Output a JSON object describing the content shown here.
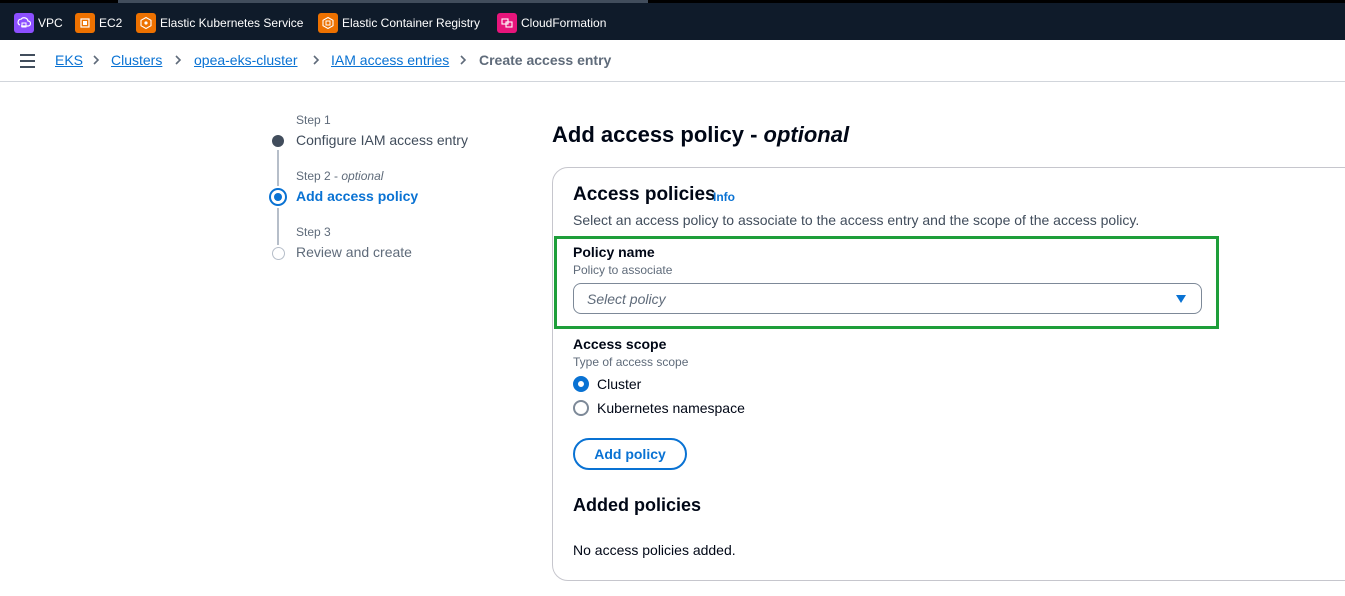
{
  "shortcuts": [
    {
      "label": "VPC",
      "icon": "vpc-icon",
      "color": "#8c4fff"
    },
    {
      "label": "EC2",
      "icon": "ec2-icon",
      "color": "#ed7100"
    },
    {
      "label": "Elastic Kubernetes Service",
      "icon": "eks-icon",
      "color": "#ed7100"
    },
    {
      "label": "Elastic Container Registry",
      "icon": "ecr-icon",
      "color": "#ed7100"
    },
    {
      "label": "CloudFormation",
      "icon": "cloudformation-icon",
      "color": "#e7157b"
    }
  ],
  "breadcrumbs": [
    {
      "label": "EKS"
    },
    {
      "label": "Clusters"
    },
    {
      "label": "opea-eks-cluster"
    },
    {
      "label": "IAM access entries"
    },
    {
      "label": "Create access entry"
    }
  ],
  "steps": [
    {
      "label": "Step 1",
      "title": "Configure IAM access entry",
      "state": "completed"
    },
    {
      "label": "Step 2",
      "optional": "optional",
      "title": "Add access policy",
      "state": "active"
    },
    {
      "label": "Step 3",
      "title": "Review and create",
      "state": "disabled"
    }
  ],
  "page": {
    "heading": "Add access policy",
    "heading_optional": "optional"
  },
  "access_policies": {
    "title": "Access policies",
    "info": "Info",
    "description": "Select an access policy to associate to the access entry and the scope of the access policy.",
    "policy_name": {
      "label": "Policy name",
      "description": "Policy to associate",
      "placeholder": "Select policy"
    },
    "access_scope": {
      "label": "Access scope",
      "description": "Type of access scope",
      "options": [
        {
          "label": "Cluster",
          "selected": true
        },
        {
          "label": "Kubernetes namespace",
          "selected": false
        }
      ]
    },
    "add_button": "Add policy",
    "added_title": "Added policies",
    "added_empty": "No access policies added."
  },
  "colors": {
    "link": "#0972d3",
    "highlight": "#1e9e3a",
    "topbar": "#0f1b2a"
  }
}
